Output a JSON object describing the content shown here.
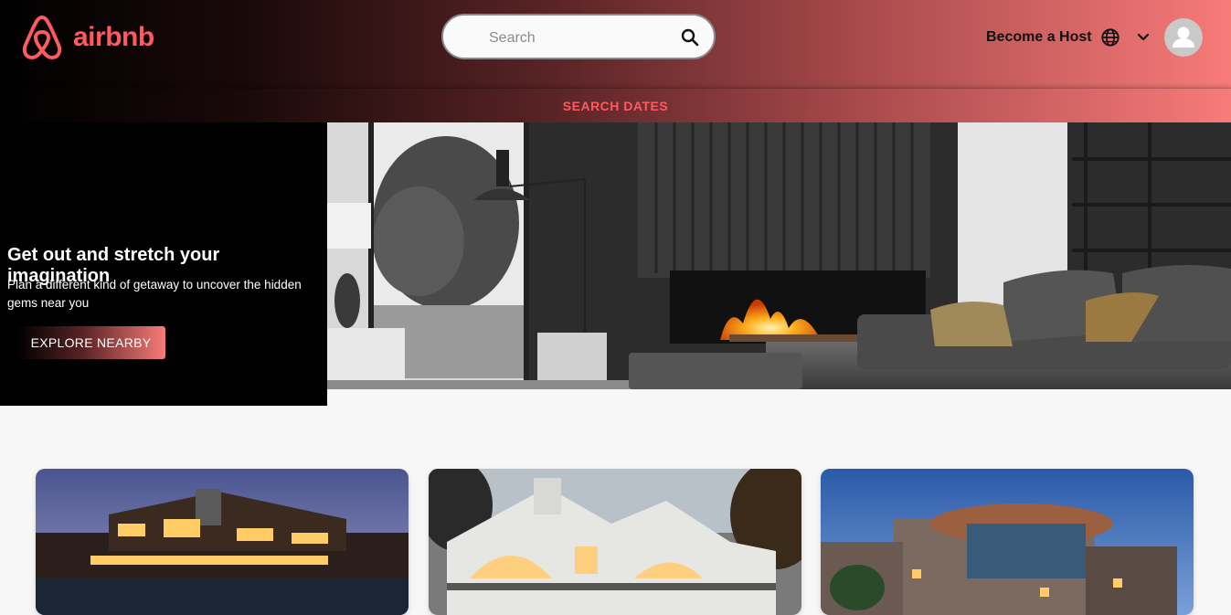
{
  "brand": {
    "name": "airbnb",
    "color": "#ff5a5f"
  },
  "search": {
    "placeholder": "Search",
    "icon": "search-icon"
  },
  "nav": {
    "become_host": "Become a Host",
    "globe_icon": "globe-icon",
    "chevron_icon": "chevron-down-icon",
    "avatar_icon": "user-avatar-icon"
  },
  "search_dates": "SEARCH DATES",
  "hero": {
    "title": "Get out and stretch your imagination",
    "subtitle": "Plan a different kind of getaway to uncover the hidden gems near you",
    "button": "EXPLORE NEARBY",
    "image": "living-room-fireplace"
  },
  "cards": [
    {
      "image": "lodge-house-dusk"
    },
    {
      "image": "white-house-evening"
    },
    {
      "image": "modern-round-house-night"
    }
  ]
}
